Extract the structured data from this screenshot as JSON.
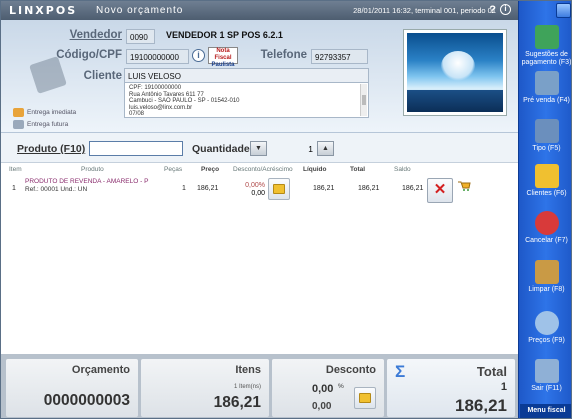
{
  "titlebar": {
    "app_logo": "LINXPOS",
    "window_title": "Novo orçamento",
    "status": "28/01/2011 16:32, terminal 001, periodo 01"
  },
  "header": {
    "seller_label": "Vendedor",
    "seller_code": "0090",
    "seller_name": "VENDEDOR 1 SP POS 6.2.1",
    "cpf_label": "Código/CPF",
    "cpf_value": "19100000000",
    "nota_fiscal_top": "Nota Fiscal",
    "nota_fiscal_bottom": "Paulista",
    "phone_label": "Telefone",
    "phone_value": "92793357",
    "client_label": "Cliente",
    "client_name": "LUIS VELOSO",
    "address_lines": [
      "CPF: 19100000000",
      "Rua Antônio Tavares 611 77",
      "Cambuci - SAO PAULO - SP - 01542-010",
      "luis.veloso@linx.com.br",
      "07/08"
    ],
    "delivery_now": "Entrega imediata",
    "delivery_future": "Entrega futura"
  },
  "entry": {
    "product_label": "Produto (F10)",
    "product_value": "",
    "quantity_label": "Quantidade",
    "quantity_value": "1"
  },
  "table": {
    "columns": [
      "Item",
      "Produto",
      "Peças",
      "Preço",
      "Desconto/Acréscimo",
      "Líquido",
      "Total",
      "Saldo"
    ],
    "rows": [
      {
        "item": "1",
        "product_name": "PRODUTO DE REVENDA - AMARELO - P",
        "product_ref": "Ref.: 00001 Und.: UN",
        "pieces": "1",
        "price": "186,21",
        "discount_percent": "0,00%",
        "discount_value": "0,00",
        "net": "186,21",
        "total": "186,21",
        "balance": "186,21"
      }
    ]
  },
  "sidebar": [
    {
      "label_1": "Sugestões de",
      "label_2": "pagamento (F3)",
      "icon": "money-icon",
      "color": "#3fa35a"
    },
    {
      "label_1": "Pré venda (F4)",
      "label_2": "",
      "icon": "presale-icon",
      "color": "#7aa0c8"
    },
    {
      "label_1": "Tipo (F5)",
      "label_2": "",
      "icon": "type-icon",
      "color": "#6b8fbd"
    },
    {
      "label_1": "Clientes (F6)",
      "label_2": "",
      "icon": "folder-icon",
      "color": "#f0c030"
    },
    {
      "label_1": "Cancelar (F7)",
      "label_2": "",
      "icon": "cancel-icon",
      "color": "#d83a3a"
    },
    {
      "label_1": "Limpar (F8)",
      "label_2": "",
      "icon": "broom-icon",
      "color": "#c99a45"
    },
    {
      "label_1": "Preços (F9)",
      "label_2": "",
      "icon": "magnifier-icon",
      "color": "#9fc2e8"
    },
    {
      "label_1": "Sair (F11)",
      "label_2": "",
      "icon": "exit-icon",
      "color": "#8fb0d6"
    }
  ],
  "sidebar_menu": "Menu fiscal",
  "footer": {
    "budget_label": "Orçamento",
    "budget_value": "0000000003",
    "items_label": "Itens",
    "items_count": "1 Item(ns)",
    "items_value": "186,21",
    "discount_label": "Desconto",
    "discount_percent": "0,00",
    "discount_percent_symbol": "%",
    "discount_value": "0,00",
    "sigma": "Σ",
    "total_label": "Total",
    "total_count": "1",
    "total_value": "186,21"
  }
}
